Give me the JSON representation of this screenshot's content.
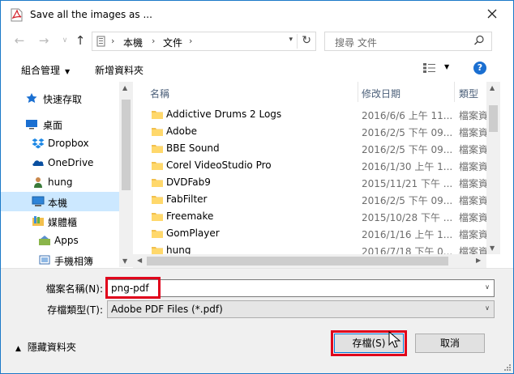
{
  "window": {
    "title": "Save all the images as ..."
  },
  "nav": {
    "crumbs": [
      "本機",
      "文件"
    ],
    "search_placeholder": "搜尋 文件"
  },
  "toolbar": {
    "organize_label": "組合管理",
    "new_folder_label": "新增資料夾"
  },
  "sidebar": {
    "items": [
      {
        "label": "快速存取",
        "icon": "star-icon"
      },
      {
        "label": "桌面",
        "icon": "desktop-icon"
      },
      {
        "label": "Dropbox",
        "icon": "dropbox-icon"
      },
      {
        "label": "OneDrive",
        "icon": "onedrive-icon"
      },
      {
        "label": "hung",
        "icon": "user-icon"
      },
      {
        "label": "本機",
        "icon": "computer-icon",
        "selected": true
      },
      {
        "label": "媒體櫃",
        "icon": "library-icon"
      },
      {
        "label": "Apps",
        "icon": "apps-icon"
      },
      {
        "label": "手機相簿",
        "icon": "phone-album-icon"
      }
    ]
  },
  "files": {
    "headers": {
      "name": "名稱",
      "date": "修改日期",
      "type": "類型"
    },
    "rows": [
      {
        "name": "Addictive Drums 2 Logs",
        "date": "2016/6/6 上午 11...",
        "type": "檔案資"
      },
      {
        "name": "Adobe",
        "date": "2016/2/5 下午 09...",
        "type": "檔案資"
      },
      {
        "name": "BBE Sound",
        "date": "2016/2/5 下午 09...",
        "type": "檔案資"
      },
      {
        "name": "Corel VideoStudio Pro",
        "date": "2016/1/30 上午 1...",
        "type": "檔案資"
      },
      {
        "name": "DVDFab9",
        "date": "2015/11/21 下午 ...",
        "type": "檔案資"
      },
      {
        "name": "FabFilter",
        "date": "2016/2/5 下午 09...",
        "type": "檔案資"
      },
      {
        "name": "Freemake",
        "date": "2015/10/28 下午 ...",
        "type": "檔案資"
      },
      {
        "name": "GomPlayer",
        "date": "2016/1/16 上午 1...",
        "type": "檔案資"
      },
      {
        "name": "hung",
        "date": "2016/7/18 下午 0...",
        "type": "檔案資"
      }
    ]
  },
  "form": {
    "filename_label": "檔案名稱(N):",
    "filename_value": "png-pdf",
    "filetype_label": "存檔類型(T):",
    "filetype_value": "Adobe PDF Files (*.pdf)"
  },
  "footer": {
    "hide_folders_label": "隱藏資料夾",
    "save_label": "存檔(S)",
    "cancel_label": "取消"
  },
  "colors": {
    "highlight": "#e0001b",
    "accent": "#0078d7",
    "selection": "#cce8ff"
  }
}
